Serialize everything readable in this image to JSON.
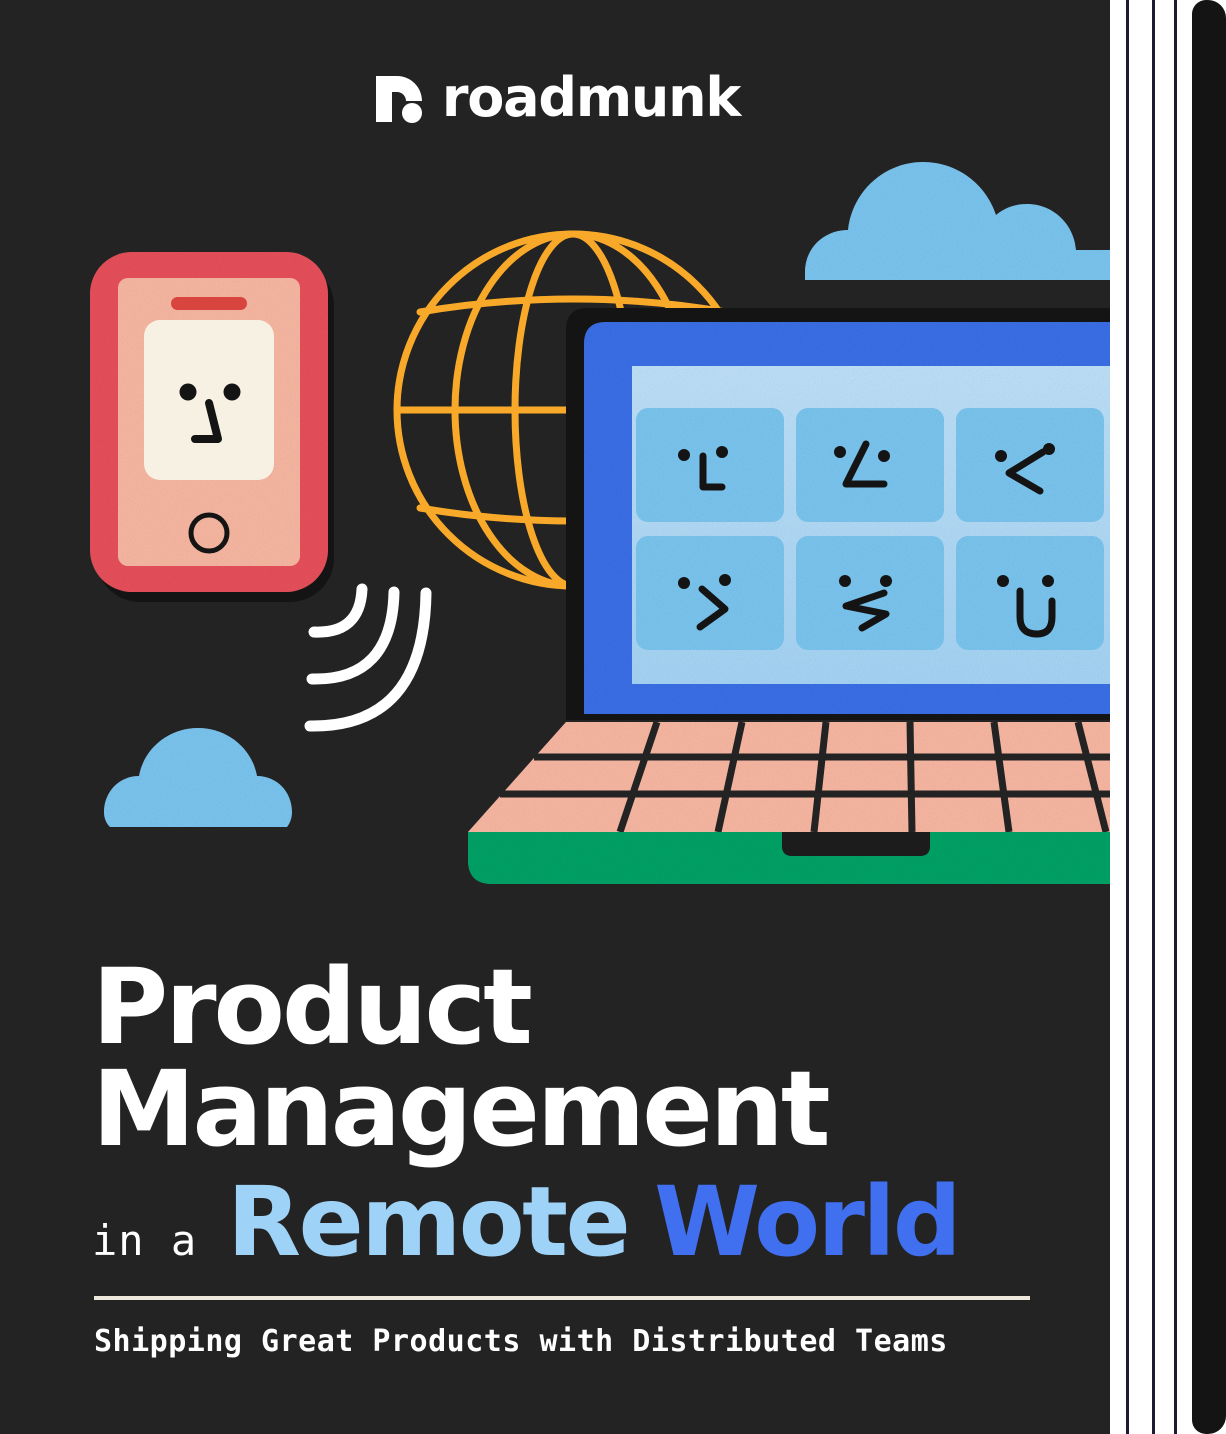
{
  "document": {
    "type": "ebook-cover",
    "background_color": "#232323"
  },
  "brand": {
    "logo_name": "roadmunk-logo",
    "wordmark": "roadmunk",
    "wordmark_color": "#FFFFFF"
  },
  "title": {
    "line1": "Product",
    "line2": "Management",
    "small_prefix": "in a",
    "accent_light": "Remote",
    "accent_bold": "World",
    "line1_color": "#FFFFFF",
    "line2_color": "#FFFFFF",
    "small_prefix_color": "#FFFFFF",
    "accent_light_color": "#9ED2F7",
    "accent_bold_color": "#4070F0"
  },
  "subtitle": {
    "text": "Shipping Great Products with Distributed Teams",
    "color": "#FFFFFF",
    "divider_color": "#EDE7DC"
  },
  "illustration": {
    "phone": {
      "name": "smartphone-illustration",
      "frame_color": "#E8505B",
      "body_color": "#F9B8A3",
      "screen_color": "#F7F1E3",
      "speaker_color": "#D8453F",
      "home_button": "circle",
      "face": "dots-and-angled-line"
    },
    "globe": {
      "name": "globe-wireframe",
      "color": "#F9A929",
      "meridians": 4,
      "parallels": 3
    },
    "laptop": {
      "name": "laptop-illustration",
      "bezel_color": "#3B6FE8",
      "screen_color": "#ACD9F7",
      "tile_color": "#7BC6F0",
      "keyboard_color": "#F9B8A3",
      "base_color": "#00A367",
      "key_line_color": "#232323",
      "video_tiles": 6,
      "tile_faces": [
        "face-neutral-left",
        "face-smirk",
        "face-frown",
        "face-grin",
        "face-squiggle",
        "face-smile"
      ]
    },
    "clouds": [
      {
        "name": "cloud-large-top-right",
        "color": "#7BC6F0"
      },
      {
        "name": "cloud-small-bottom-left",
        "color": "#7BC6F0"
      }
    ],
    "signal_waves": {
      "name": "wifi-signal-arcs",
      "color": "#FFFFFF",
      "count": 3
    }
  },
  "binding": {
    "page_edge_color": "#FFFFFF",
    "page_line_color": "#1B1B33",
    "page_line_count": 3,
    "spine_color": "#141414"
  }
}
